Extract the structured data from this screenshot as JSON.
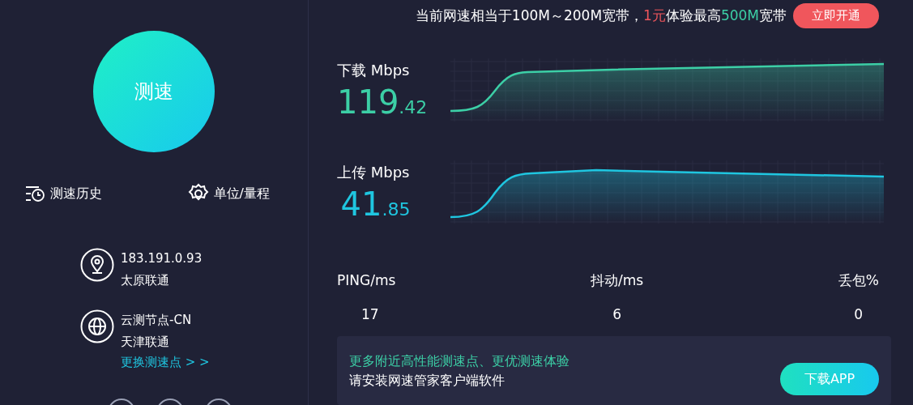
{
  "test_button": {
    "label": "测速"
  },
  "tools": [
    {
      "kind": "history",
      "label": "测速历史"
    },
    {
      "kind": "settings",
      "label": "单位/量程"
    }
  ],
  "connection": [
    {
      "kind": "location",
      "lines": [
        "183.191.0.93",
        "太原联通"
      ]
    },
    {
      "kind": "server",
      "lines": [
        "云测节点-CN",
        "天津联通"
      ],
      "link": "更换测速点 > >"
    }
  ],
  "offer": {
    "segments": [
      {
        "text": "当前网速相当于100M～200M宽带，",
        "color": "#ffffff"
      },
      {
        "text": "1元",
        "color": "#f0565c"
      },
      {
        "text": "体验最高",
        "color": "#ffffff"
      },
      {
        "text": "500M",
        "color": "#3ccfa6"
      },
      {
        "text": "宽带",
        "color": "#ffffff"
      }
    ],
    "button": "立即开通"
  },
  "speeds": [
    {
      "kind": "download",
      "label": "下载 Mbps",
      "integer": "119",
      "decimal": ".42"
    },
    {
      "kind": "upload",
      "label": "上传 Mbps",
      "integer": "41",
      "decimal": ".85"
    }
  ],
  "stats": [
    {
      "label": "PING/ms",
      "value": "17"
    },
    {
      "label": "抖动/ms",
      "value": "6"
    },
    {
      "label": "丢包%",
      "value": "0"
    }
  ],
  "app_banner": {
    "headline": "更多附近高性能测速点、更优测速体验",
    "subtext": "请安装网速管家客户端软件",
    "button": "下载APP"
  }
}
